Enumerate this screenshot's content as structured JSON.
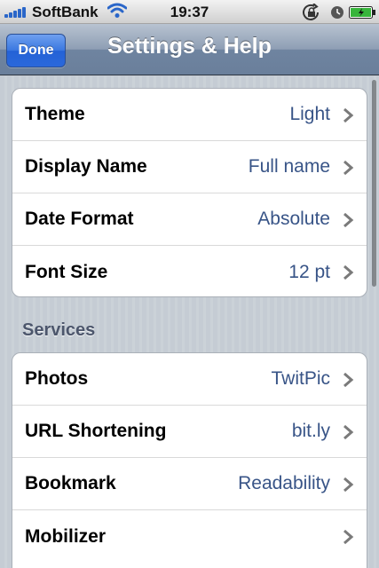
{
  "status_bar": {
    "carrier": "SoftBank",
    "time": "19:37",
    "icons": [
      "signal-icon",
      "wifi-icon",
      "rotation-lock-icon",
      "alarm-icon",
      "battery-icon"
    ]
  },
  "nav": {
    "done_label": "Done",
    "title": "Settings & Help"
  },
  "groups": [
    {
      "rows": [
        {
          "label": "Theme",
          "value": "Light"
        },
        {
          "label": "Display Name",
          "value": "Full name"
        },
        {
          "label": "Date Format",
          "value": "Absolute"
        },
        {
          "label": "Font Size",
          "value": "12 pt"
        }
      ]
    },
    {
      "header": "Services",
      "rows": [
        {
          "label": "Photos",
          "value": "TwitPic"
        },
        {
          "label": "URL Shortening",
          "value": "bit.ly"
        },
        {
          "label": "Bookmark",
          "value": "Readability"
        },
        {
          "label": "Mobilizer",
          "value": ""
        }
      ]
    }
  ],
  "colors": {
    "value_text": "#385487",
    "done_button": "#2a68db",
    "nav_bar": "#6f84a0",
    "background": "#c5ccd4"
  }
}
